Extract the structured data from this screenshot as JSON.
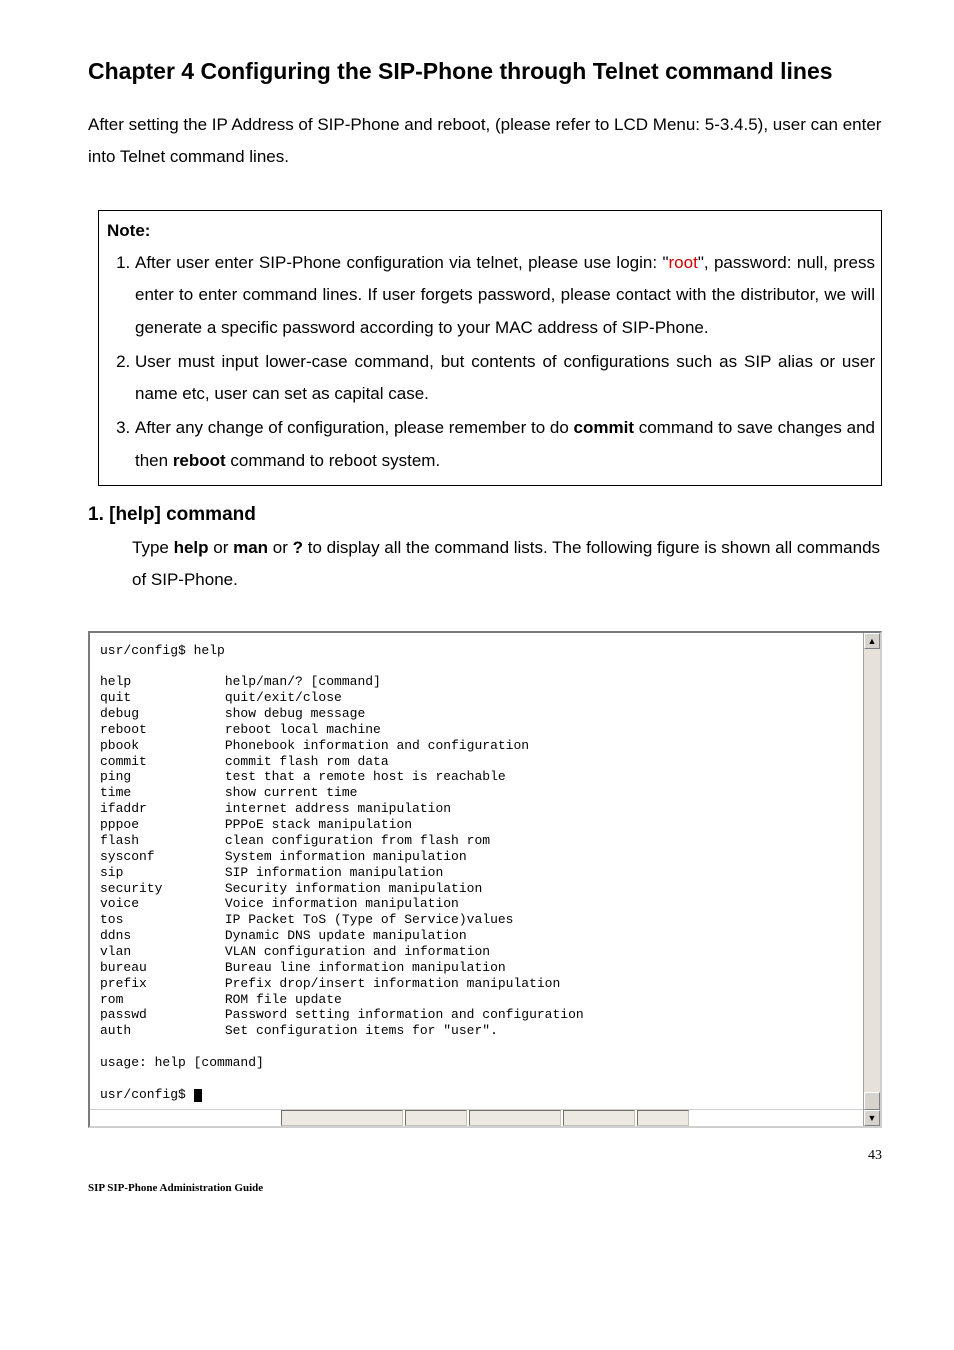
{
  "chapter_title": "Chapter 4 Configuring the SIP-Phone through Telnet command lines",
  "intro": "After setting the IP Address of SIP-Phone and reboot, (please refer to LCD Menu: 5-3.4.5), user can enter into Telnet command lines.",
  "note": {
    "title": "Note:",
    "items_html": [
      "After user enter SIP-Phone configuration via telnet, please use login: \"<span class=\"root\">root</span>\", password: null, press enter to enter command lines. If user forgets password, please contact with the distributor, we will generate a specific password according to your MAC address of SIP-Phone.",
      "User must input lower-case command, but contents of configurations such as SIP alias or user name etc, user can set as capital case.",
      "After any change of configuration, please remember to do <span class=\"bold\">commit</span> command to save changes and then <span class=\"bold\">reboot</span> command to reboot system."
    ]
  },
  "section": {
    "title": "1. [help] command",
    "body_html": "Type <span class=\"bold\">help</span> or <span class=\"bold\">man</span> or <span class=\"bold\">?</span> to display all the command lists. The following figure is shown all commands of SIP-Phone."
  },
  "terminal": {
    "prompt1": "usr/config$ help",
    "rows": [
      [
        "help",
        "help/man/? [command]"
      ],
      [
        "quit",
        "quit/exit/close"
      ],
      [
        "debug",
        "show debug message"
      ],
      [
        "reboot",
        "reboot local machine"
      ],
      [
        "pbook",
        "Phonebook information and configuration"
      ],
      [
        "commit",
        "commit flash rom data"
      ],
      [
        "ping",
        "test that a remote host is reachable"
      ],
      [
        "time",
        "show current time"
      ],
      [
        "ifaddr",
        "internet address manipulation"
      ],
      [
        "pppoe",
        "PPPoE stack manipulation"
      ],
      [
        "flash",
        "clean configuration from flash rom"
      ],
      [
        "sysconf",
        "System information manipulation"
      ],
      [
        "sip",
        "SIP information manipulation"
      ],
      [
        "security",
        "Security information manipulation"
      ],
      [
        "voice",
        "Voice information manipulation"
      ],
      [
        "tos",
        "IP Packet ToS (Type of Service)values"
      ],
      [
        "ddns",
        "Dynamic DNS update manipulation"
      ],
      [
        "vlan",
        "VLAN configuration and information"
      ],
      [
        "bureau",
        "Bureau line information manipulation"
      ],
      [
        "prefix",
        "Prefix drop/insert information manipulation"
      ],
      [
        "rom",
        "ROM file update"
      ],
      [
        "passwd",
        "Password setting information and configuration"
      ],
      [
        "auth",
        "Set configuration items for \"user\"."
      ]
    ],
    "usage": "usage: help [command]",
    "prompt2": "usr/config$ "
  },
  "page_number": "43",
  "footer": "SIP SIP-Phone   Administration Guide"
}
